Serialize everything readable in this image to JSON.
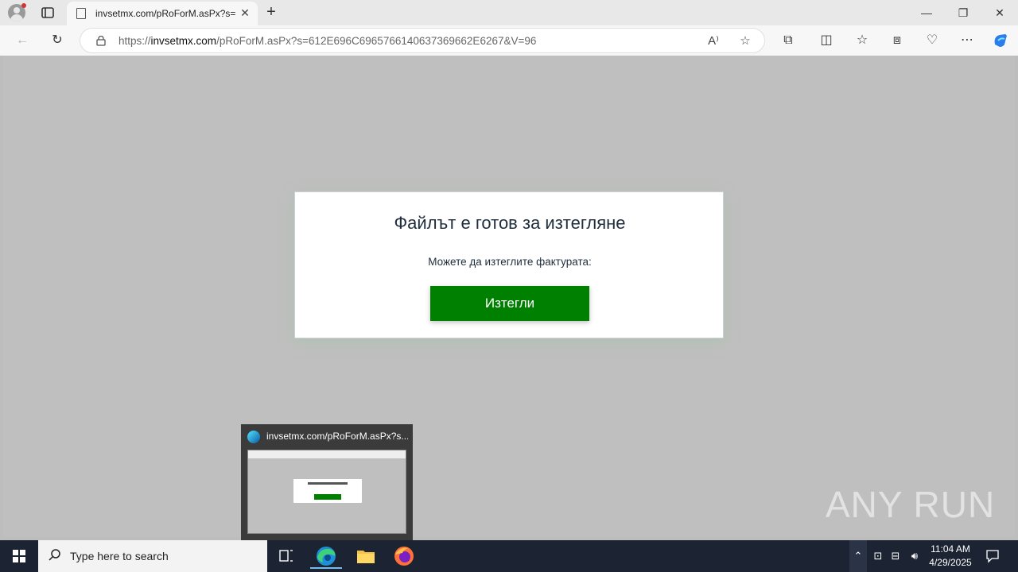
{
  "browser": {
    "tab_title": "invsetmx.com/pRoForM.asPx?s=",
    "url_prefix": "https://",
    "url_domain": "invsetmx.com",
    "url_path": "/pRoForM.asPx?s=612E696C6965766140637369662E6267&V=96"
  },
  "page": {
    "heading": "Файлът е готов за изтегляне",
    "message": "Можете да изтеглите фактурата:",
    "button_label": "Изтегли",
    "button_color": "#008000"
  },
  "thumbnail": {
    "title": "invsetmx.com/pRoForM.asPx?s..."
  },
  "watermark": "ANY RUN",
  "taskbar": {
    "search_placeholder": "Type here to search",
    "time": "11:04 AM",
    "date": "4/29/2025"
  }
}
